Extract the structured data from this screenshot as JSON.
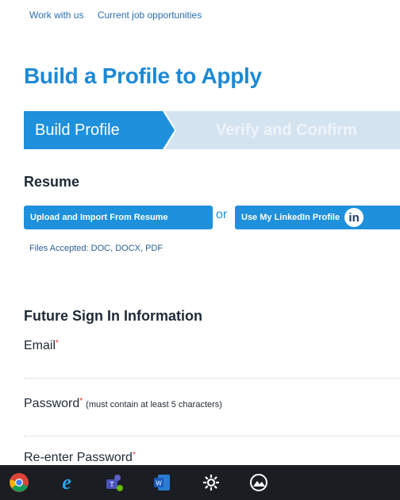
{
  "breadcrumb": {
    "items": [
      "Work with us",
      "Current job opportunities"
    ]
  },
  "page_title": "Build a Profile to Apply",
  "stepper": {
    "steps": [
      "Build Profile",
      "Verify and Confirm"
    ]
  },
  "resume": {
    "title": "Resume",
    "upload_label": "Upload and Import From Resume",
    "or_text": "or",
    "linkedin_label": "Use My LinkedIn Profile",
    "linkedin_icon_text": "in",
    "files_note": "Files Accepted: DOC, DOCX, PDF"
  },
  "signin": {
    "title": "Future Sign In Information",
    "email_label": "Email",
    "password_label": "Password",
    "password_hint": "(must contain at least 5 characters)",
    "reenter_label": "Re-enter Password",
    "required_mark": "*"
  },
  "taskbar": {
    "icons": [
      "chrome-icon",
      "internet-explorer-icon",
      "teams-icon",
      "word-icon",
      "settings-icon",
      "photos-icon"
    ]
  },
  "colors": {
    "accent": "#1e90dc",
    "taskbar": "#1a1d22"
  }
}
